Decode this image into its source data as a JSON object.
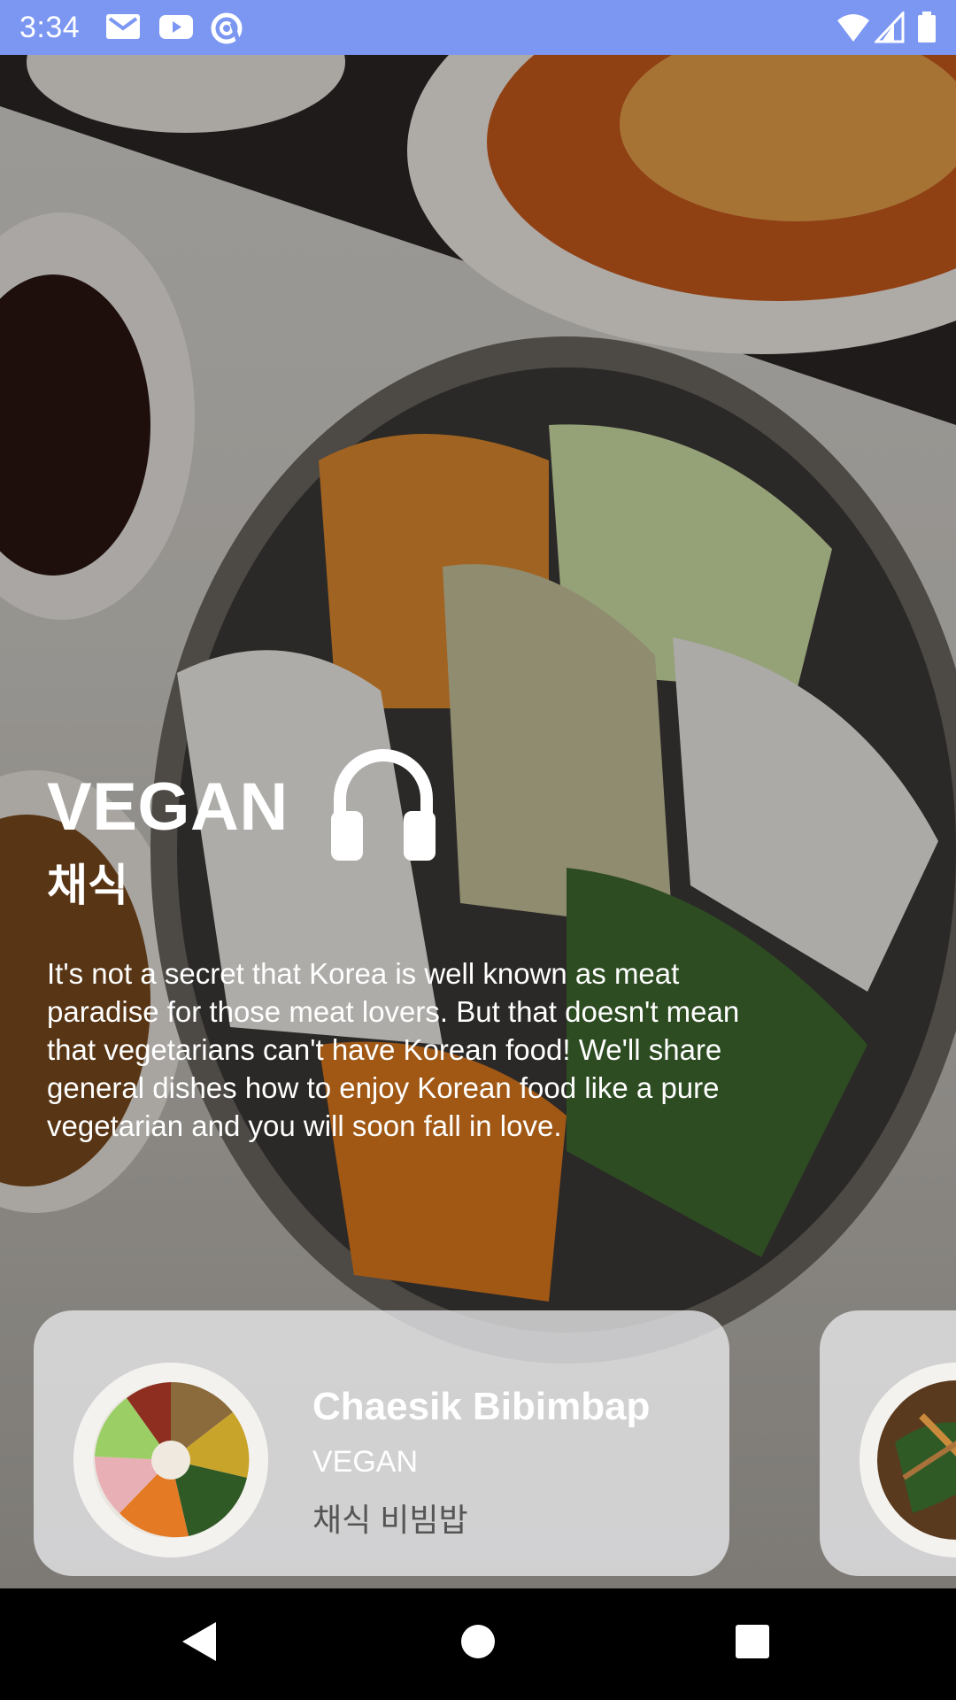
{
  "status_bar": {
    "time": "3:34",
    "left_icons": [
      "gmail-icon",
      "youtube-icon",
      "at-sign-icon"
    ],
    "right_icons": [
      "wifi-icon",
      "signal-icon",
      "battery-icon"
    ],
    "color": "#7b97f2"
  },
  "hero": {
    "title": "VEGAN",
    "subtitle": "채식",
    "description": "It's not a secret that Korea is well known as meat paradise for those meat lovers. But that doesn't mean that vegetarians can't have Korean food! We'll share general dishes how to enjoy Korean food like a pure vegetarian and you will soon fall in love.",
    "audio_icon": "headphones-icon"
  },
  "cards": [
    {
      "name": "Chaesik Bibimbap",
      "category": "VEGAN",
      "korean": "채식 비빔밥"
    }
  ],
  "nav_bar": {
    "buttons": [
      "back-icon",
      "home-icon",
      "recents-icon"
    ]
  }
}
